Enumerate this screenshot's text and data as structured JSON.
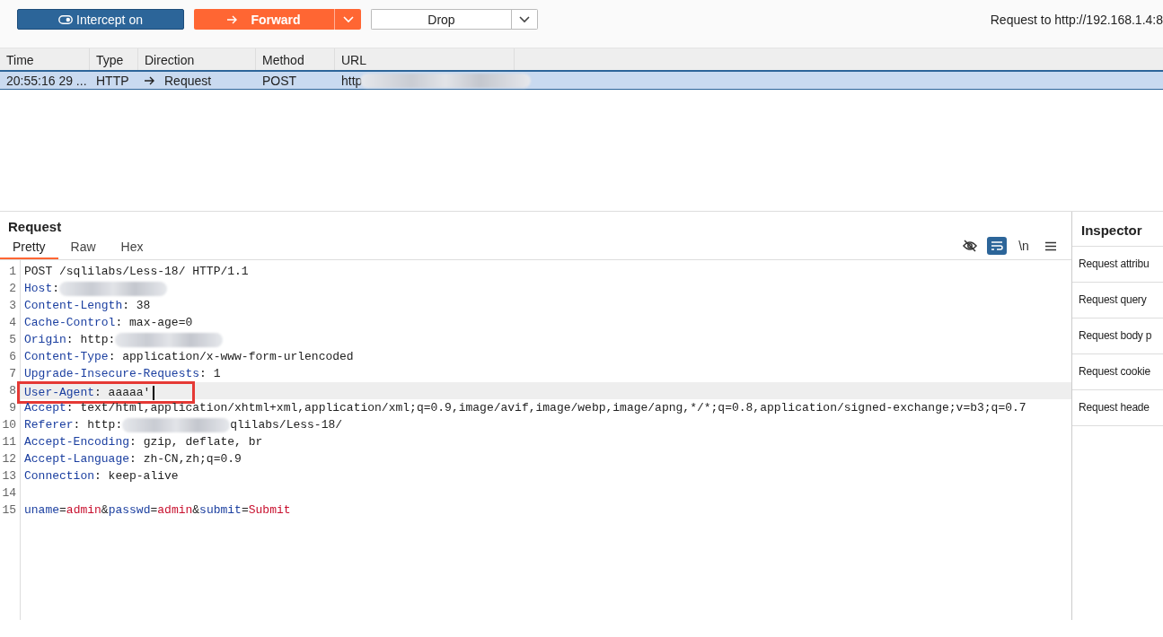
{
  "toolbar": {
    "buttons": [
      {
        "kind": "intercept",
        "label": "Intercept on"
      },
      {
        "kind": "forward",
        "label": "Forward"
      },
      {
        "kind": "drop",
        "label": "Drop"
      }
    ],
    "target": "Request to http://192.168.1.4:8"
  },
  "table": {
    "columns": [
      "Time",
      "Type",
      "Direction",
      "Method",
      "URL"
    ],
    "rows": [
      {
        "selected": true,
        "cells": [
          "20:55:16 29 ...",
          "HTTP",
          "Request",
          "POST",
          "http"
        ]
      }
    ]
  },
  "request": {
    "title": "Request",
    "tabs": [
      {
        "label": "Pretty",
        "selected": true
      },
      {
        "label": "Raw",
        "selected": false
      },
      {
        "label": "Hex",
        "selected": false
      }
    ],
    "tools": [
      {
        "kind": "hide",
        "selected": false
      },
      {
        "kind": "wrap",
        "selected": true
      },
      {
        "kind": "newline",
        "label": "\\n",
        "selected": false
      },
      {
        "kind": "menu",
        "selected": false
      }
    ],
    "lines": [
      {
        "number": "1",
        "segments": [
          {
            "kind": "plain",
            "text": "POST /sqlilabs/Less-18/ HTTP/1.1"
          }
        ]
      },
      {
        "number": "2",
        "segments": [
          {
            "kind": "name",
            "text": "Host"
          },
          {
            "kind": "plain",
            "text": ":"
          },
          {
            "kind": "redacted"
          }
        ]
      },
      {
        "number": "3",
        "segments": [
          {
            "kind": "name",
            "text": "Content-Length"
          },
          {
            "kind": "plain",
            "text": ": 38"
          }
        ]
      },
      {
        "number": "4",
        "segments": [
          {
            "kind": "name",
            "text": "Cache-Control"
          },
          {
            "kind": "plain",
            "text": ": max-age=0"
          }
        ]
      },
      {
        "number": "5",
        "segments": [
          {
            "kind": "name",
            "text": "Origin"
          },
          {
            "kind": "plain",
            "text": ": http:"
          },
          {
            "kind": "redacted"
          }
        ]
      },
      {
        "number": "6",
        "segments": [
          {
            "kind": "name",
            "text": "Content-Type"
          },
          {
            "kind": "plain",
            "text": ": application/x-www-form-urlencoded"
          }
        ]
      },
      {
        "number": "7",
        "segments": [
          {
            "kind": "name",
            "text": "Upgrade-Insecure-Requests"
          },
          {
            "kind": "plain",
            "text": ": 1"
          }
        ]
      },
      {
        "number": "8",
        "current": true,
        "boxed": true,
        "segments": [
          {
            "kind": "name",
            "text": "User-Agent"
          },
          {
            "kind": "plain",
            "text": ": aaaaa'"
          }
        ]
      },
      {
        "number": "9",
        "segments": [
          {
            "kind": "name",
            "text": "Accept"
          },
          {
            "kind": "plain",
            "text": ": text/html,application/xhtml+xml,application/xml;q=0.9,image/avif,image/webp,image/apng,*/*;q=0.8,application/signed-exchange;v=b3;q=0.7"
          }
        ]
      },
      {
        "number": "10",
        "segments": [
          {
            "kind": "name",
            "text": "Referer"
          },
          {
            "kind": "plain",
            "text": ": http:"
          },
          {
            "kind": "redacted"
          },
          {
            "kind": "plain",
            "text": "qlilabs/Less-18/"
          }
        ]
      },
      {
        "number": "11",
        "segments": [
          {
            "kind": "name",
            "text": "Accept-Encoding"
          },
          {
            "kind": "plain",
            "text": ": gzip, deflate, br"
          }
        ]
      },
      {
        "number": "12",
        "segments": [
          {
            "kind": "name",
            "text": "Accept-Language"
          },
          {
            "kind": "plain",
            "text": ": zh-CN,zh;q=0.9"
          }
        ]
      },
      {
        "number": "13",
        "segments": [
          {
            "kind": "name",
            "text": "Connection"
          },
          {
            "kind": "plain",
            "text": ": keep-alive"
          }
        ]
      },
      {
        "number": "14"
      },
      {
        "number": "15",
        "segments": [
          {
            "kind": "name",
            "text": "uname"
          },
          {
            "kind": "plain",
            "text": "="
          },
          {
            "kind": "value",
            "text": "admin"
          },
          {
            "kind": "plain",
            "text": "&"
          },
          {
            "kind": "name",
            "text": "passwd"
          },
          {
            "kind": "plain",
            "text": "="
          },
          {
            "kind": "value",
            "text": "admin"
          },
          {
            "kind": "plain",
            "text": "&"
          },
          {
            "kind": "name",
            "text": "submit"
          },
          {
            "kind": "plain",
            "text": "="
          },
          {
            "kind": "value",
            "text": "Submit"
          }
        ]
      }
    ]
  },
  "inspector": {
    "title": "Inspector",
    "items": [
      "Request attribu",
      "Request query",
      "Request body p",
      "Request cookie",
      "Request heade"
    ]
  }
}
